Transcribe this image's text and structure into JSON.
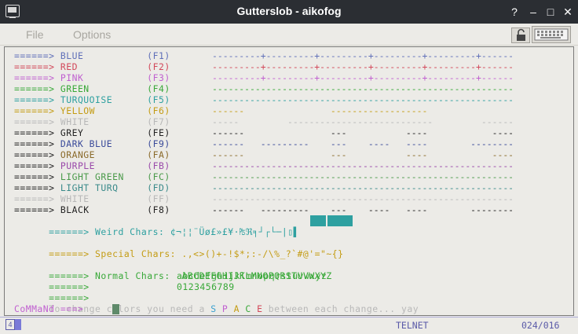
{
  "window": {
    "title": "Gutterslob - aikofog",
    "controls": {
      "help": "?",
      "minimize": "–",
      "maximize": "□",
      "close": "✕"
    }
  },
  "menu": {
    "file": "File",
    "options": "Options"
  },
  "toolbar_icons": {
    "lock": "lock-icon",
    "keyboard": "keyboard-icon"
  },
  "colors": {
    "blue": "#5f6fb8",
    "red": "#d2485a",
    "pink": "#c060d0",
    "green": "#38a838",
    "turquoise": "#2ea0a0",
    "yellow": "#c49c14",
    "white": "#b8b8b8",
    "grey": "#222222",
    "dark_blue": "#3a4a9a",
    "orange": "#8a6a2a",
    "purple": "#9a4aaa",
    "light_green": "#4a9a4a",
    "light_turq": "#3a8a8a",
    "black": "#222222"
  },
  "terminal": {
    "color_rows": [
      {
        "arrow": "======>",
        "name": "BLUE",
        "key": "(F1)"
      },
      {
        "arrow": "======>",
        "name": "RED",
        "key": "(F2)"
      },
      {
        "arrow": "======>",
        "name": "PINK",
        "key": "(F3)"
      },
      {
        "arrow": "======>",
        "name": "GREEN",
        "key": "(F4)"
      },
      {
        "arrow": "======>",
        "name": "TURQUOISE",
        "key": "(F5)"
      },
      {
        "arrow": "======>",
        "name": "YELLOW",
        "key": "(F6)"
      },
      {
        "arrow": "======>",
        "name": "WHITE",
        "key": "(F7)"
      },
      {
        "arrow": "======>",
        "name": "GREY",
        "key": "(FE)"
      },
      {
        "arrow": "======>",
        "name": "DARK BLUE",
        "key": "(F9)"
      },
      {
        "arrow": "======>",
        "name": "ORANGE",
        "key": "(FA)"
      },
      {
        "arrow": "======>",
        "name": "PURPLE",
        "key": "(FB)"
      },
      {
        "arrow": "======>",
        "name": "LIGHT GREEN",
        "key": "(FC)"
      },
      {
        "arrow": "======>",
        "name": "LIGHT TURQ",
        "key": "(FD)"
      },
      {
        "arrow": "======>",
        "name": "WHITE",
        "key": "(FF)"
      },
      {
        "arrow": "======>",
        "name": "BLACK",
        "key": "(F8)"
      }
    ],
    "weird": {
      "arrow": "======>",
      "label": "Weird Chars:",
      "chars": "¢¬¦¦¨Üø£»£¥·₧ℜ╕┘┌└─|▯▌"
    },
    "special": {
      "arrow": "======>",
      "label": "Special Chars:",
      "chars": ".,<>()+-!$*;:-/\\%_?`#@'=\"~{}"
    },
    "normal": {
      "arrow": "======>",
      "label": "Normal Chars:",
      "upper": "ABCDEFGHIJKLMNOPQRSTUVWXYZ",
      "lower": "abcdefghijklmnopqrstuvwxyz",
      "digits": "0123456789"
    },
    "hint_before": "To change colors you need a ",
    "hint_letters": [
      "S",
      "P",
      "A",
      "C",
      "E"
    ],
    "hint_after": " between each change... yay",
    "prompt": "CoMMaNd ===>"
  },
  "status": {
    "indicator": "4",
    "mode": "TELNET",
    "position": "024/016"
  }
}
